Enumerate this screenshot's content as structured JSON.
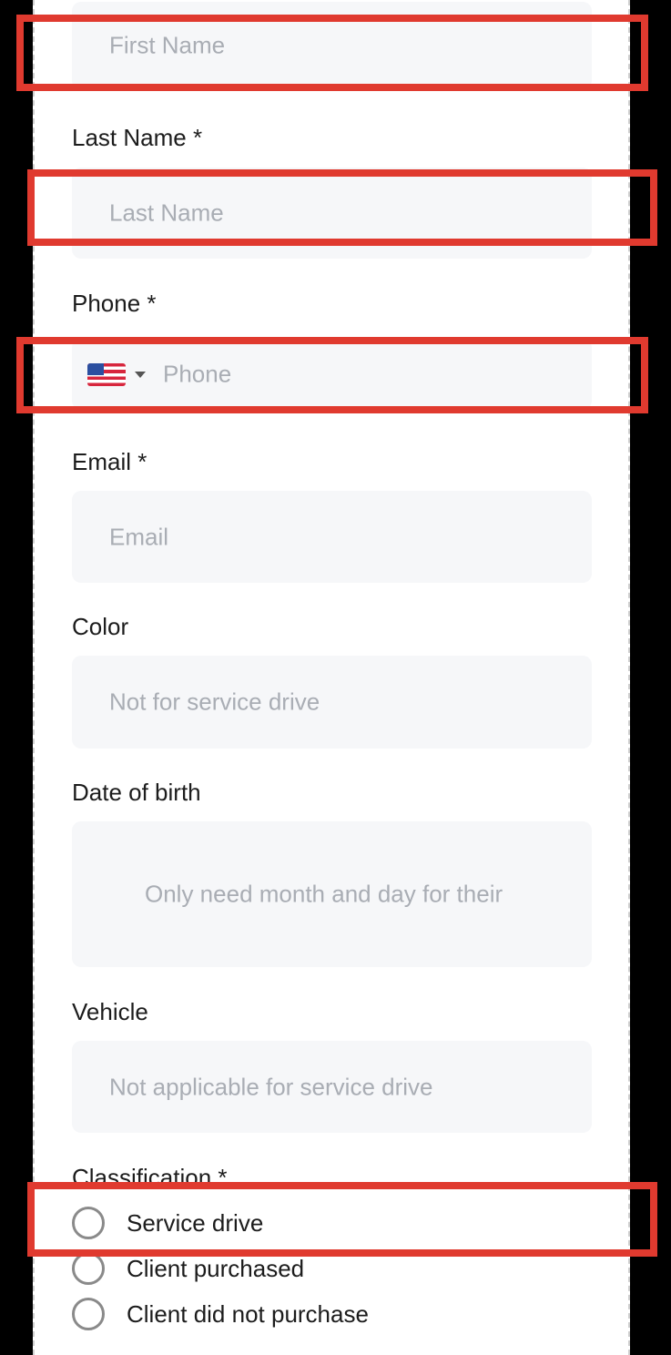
{
  "form": {
    "first_name": {
      "placeholder": "First Name"
    },
    "last_name": {
      "label": "Last Name *",
      "placeholder": "Last Name"
    },
    "phone": {
      "label": "Phone *",
      "placeholder": "Phone",
      "country_flag": "us-flag-icon"
    },
    "email": {
      "label": "Email *",
      "placeholder": "Email"
    },
    "color": {
      "label": "Color",
      "placeholder": "Not for service drive"
    },
    "date_of_birth": {
      "label": "Date of birth",
      "placeholder": "Only need month and day for their"
    },
    "vehicle": {
      "label": "Vehicle",
      "placeholder": "Not applicable for service drive"
    },
    "classification": {
      "label": "Classification *",
      "options": [
        "Service drive",
        "Client purchased",
        "Client did not purchase"
      ]
    }
  },
  "colors": {
    "highlight": "#e03a2f",
    "field_bg": "#f6f7f9",
    "placeholder": "#a9adb4"
  }
}
